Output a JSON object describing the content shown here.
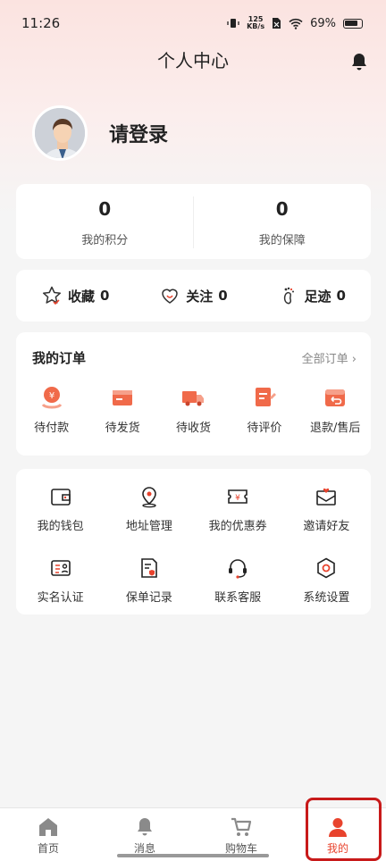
{
  "status_bar": {
    "time": "11:26",
    "net_speed_top": "125",
    "net_speed_bottom": "KB/s",
    "battery": "69%"
  },
  "header": {
    "title": "个人中心"
  },
  "profile": {
    "login_label": "请登录"
  },
  "stats": [
    {
      "value": "0",
      "label": "我的积分"
    },
    {
      "value": "0",
      "label": "我的保障"
    }
  ],
  "quick_links": [
    {
      "label": "收藏",
      "count": "0",
      "icon": "star-icon"
    },
    {
      "label": "关注",
      "count": "0",
      "icon": "heart-icon"
    },
    {
      "label": "足迹",
      "count": "0",
      "icon": "footprint-icon"
    }
  ],
  "orders": {
    "title": "我的订单",
    "all_label": "全部订单",
    "items": [
      {
        "label": "待付款",
        "icon": "payment-icon"
      },
      {
        "label": "待发货",
        "icon": "package-icon"
      },
      {
        "label": "待收货",
        "icon": "truck-icon"
      },
      {
        "label": "待评价",
        "icon": "review-icon"
      },
      {
        "label": "退款/售后",
        "icon": "refund-icon"
      }
    ]
  },
  "tools": [
    {
      "label": "我的钱包",
      "icon": "wallet-icon"
    },
    {
      "label": "地址管理",
      "icon": "location-icon"
    },
    {
      "label": "我的优惠券",
      "icon": "coupon-icon"
    },
    {
      "label": "邀请好友",
      "icon": "invite-icon"
    },
    {
      "label": "实名认证",
      "icon": "id-card-icon"
    },
    {
      "label": "保单记录",
      "icon": "policy-icon"
    },
    {
      "label": "联系客服",
      "icon": "headset-icon"
    },
    {
      "label": "系统设置",
      "icon": "settings-icon"
    }
  ],
  "tabbar": [
    {
      "label": "首页",
      "icon": "home-icon"
    },
    {
      "label": "消息",
      "icon": "bell-icon"
    },
    {
      "label": "购物车",
      "icon": "cart-icon"
    },
    {
      "label": "我的",
      "icon": "user-icon",
      "active": true
    }
  ],
  "colors": {
    "accent": "#e8432d",
    "tab_inactive": "#8a8a8a"
  }
}
